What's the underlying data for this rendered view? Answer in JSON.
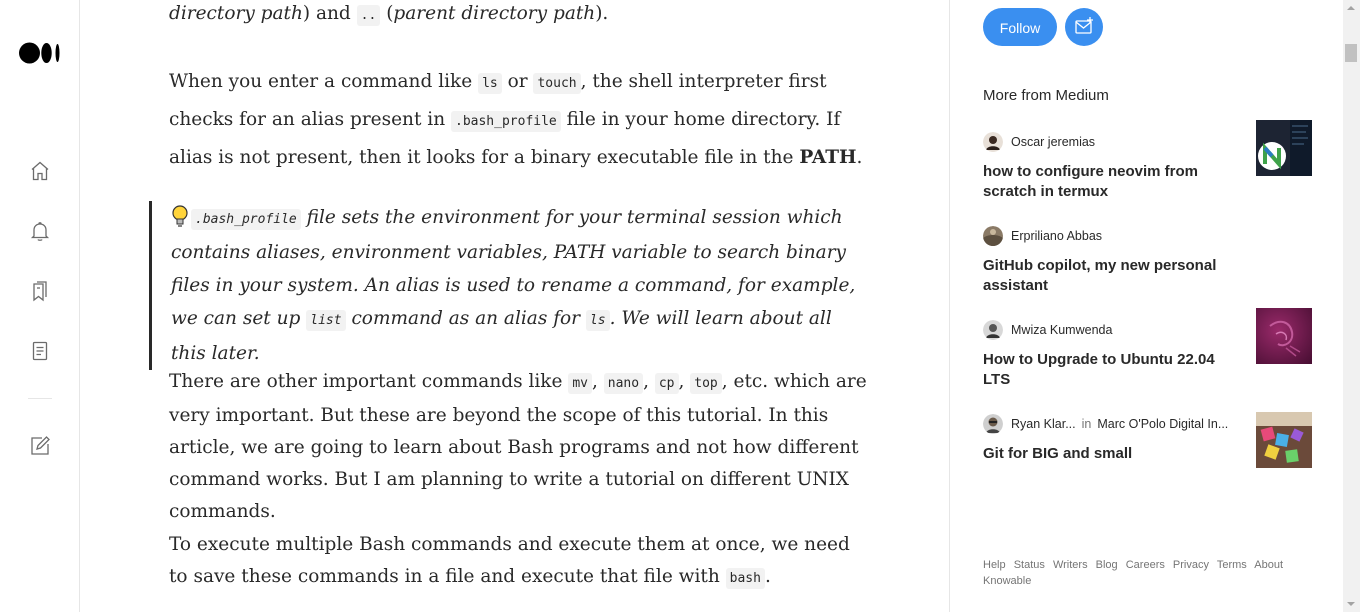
{
  "left_nav": {
    "items": [
      "home",
      "notifications",
      "lists",
      "stories",
      "write"
    ]
  },
  "article": {
    "p0": {
      "t1": "directory path",
      "t2": ") and ",
      "code1": "..",
      "t3": " (",
      "t4": "parent directory path",
      "t5": ")."
    },
    "p1": {
      "t1": "When you enter a command like ",
      "code1": "ls",
      "t2": " or ",
      "code2": "touch",
      "t3": ", the shell interpreter first checks for an alias present in ",
      "code3": ".bash_profile",
      "t4": " file in your home directory. If alias is not present, then it looks for a binary executable file in the ",
      "bold": "PATH",
      "t5": "."
    },
    "quote": {
      "code1": ".bash_profile",
      "t1": " file sets the environment for your terminal session which contains aliases, environment variables, PATH variable to search binary files in your system. An alias is used to rename a command, for example, we can set up ",
      "code2": "list",
      "t2": " command as an alias for ",
      "code3": "ls",
      "t3": ". We will learn about all this later."
    },
    "p2": {
      "t1": "There are other important commands like ",
      "code1": "mv",
      "sep1": ", ",
      "code2": "nano",
      "sep2": ", ",
      "code3": "cp",
      "sep3": ", ",
      "code4": "top",
      "t2": ", etc. which are very important. But these are beyond the scope of this tutorial. In this article, we are going to learn about Bash programs and not how different command works. But I am planning to write a tutorial on different UNIX commands."
    },
    "p3": {
      "t1": "To execute multiple Bash commands and execute them at once, we need to save these commands in a file and execute that file with ",
      "code1": "bash",
      "t2": "."
    }
  },
  "sidebar": {
    "follow_label": "Follow",
    "more_title": "More from Medium",
    "stories": [
      {
        "author": "Oscar jeremias",
        "publication": "",
        "title": "how to configure neovim from scratch in termux"
      },
      {
        "author": "Erpriliano Abbas",
        "publication": "",
        "title": "GitHub copilot, my new personal assistant"
      },
      {
        "author": "Mwiza Kumwenda",
        "publication": "",
        "title": "How to Upgrade to Ubuntu 22.04 LTS"
      },
      {
        "author": "Ryan Klar...",
        "in": "in",
        "publication": "Marc O'Polo Digital In...",
        "title": "Git for BIG and small"
      }
    ],
    "footer": [
      "Help",
      "Status",
      "Writers",
      "Blog",
      "Careers",
      "Privacy",
      "Terms",
      "About",
      "Knowable"
    ]
  },
  "colors": {
    "accent": "#3a8ff0",
    "text": "#292929",
    "muted": "#757575"
  }
}
